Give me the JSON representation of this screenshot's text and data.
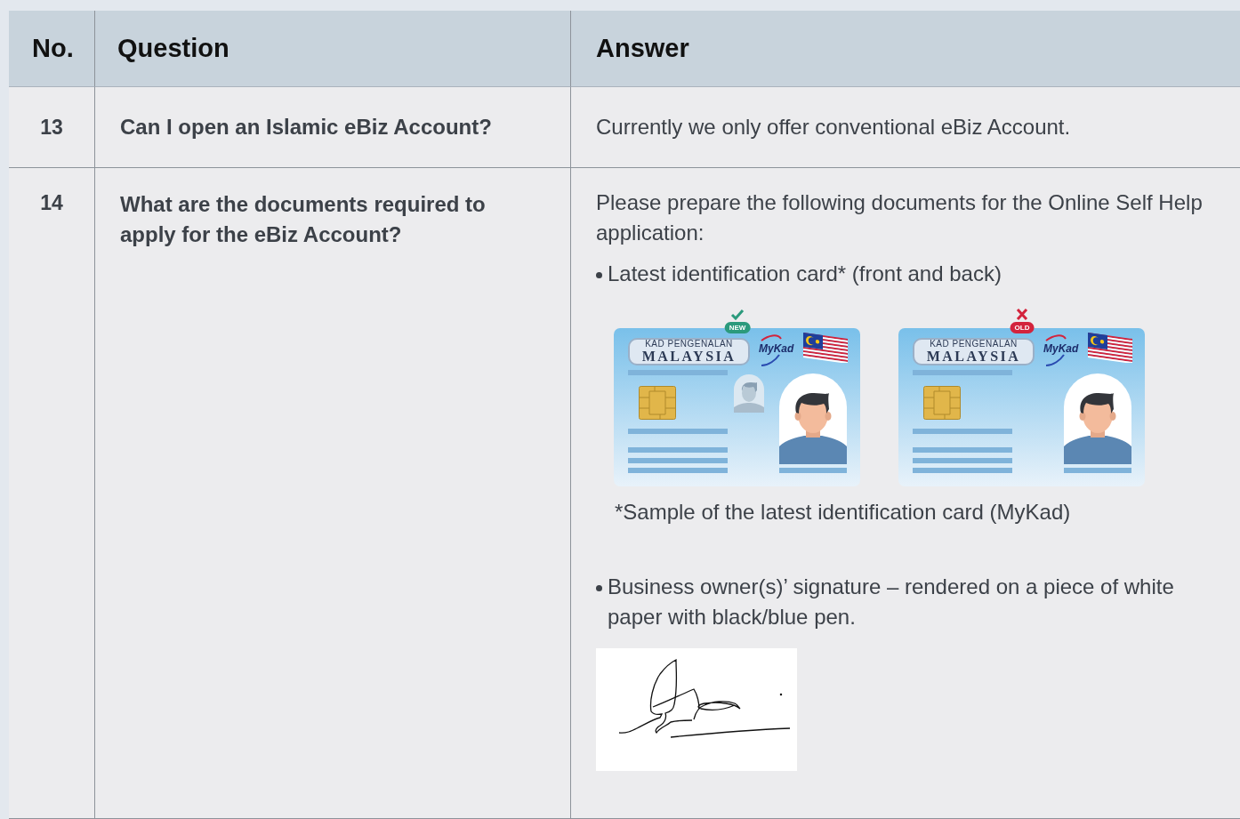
{
  "table": {
    "columns": [
      "No.",
      "Question",
      "Answer"
    ],
    "rows": [
      {
        "no": "13",
        "question": "Can I open an Islamic eBiz Account?",
        "answer": [
          {
            "kind": "paragraph",
            "text": "Currently we only offer conventional eBiz Account."
          }
        ]
      },
      {
        "no": "14",
        "question": "What are the documents required to apply for the eBiz Account?",
        "answer": [
          {
            "kind": "paragraph",
            "text": "Please prepare the following documents for the Online Self Help application:"
          },
          {
            "kind": "bullet",
            "text": "Latest identification card* (front and back)"
          },
          {
            "kind": "cards",
            "cards": [
              {
                "badge": "NEW",
                "valid": true,
                "title": "KAD PENGENALAN",
                "subtitle": "MALAYSIA",
                "logo": "MyKad",
                "ghost_photo": true
              },
              {
                "badge": "OLD",
                "valid": false,
                "title": "KAD PENGENALAN",
                "subtitle": "MALAYSIA",
                "logo": "MyKad",
                "ghost_photo": false
              }
            ]
          },
          {
            "kind": "caption",
            "text": "*Sample of the latest identification card (MyKad)"
          },
          {
            "kind": "bullet",
            "text": "Business owner(s)’ signature – rendered on a piece of white paper with black/blue pen."
          },
          {
            "kind": "signature"
          }
        ]
      }
    ]
  }
}
